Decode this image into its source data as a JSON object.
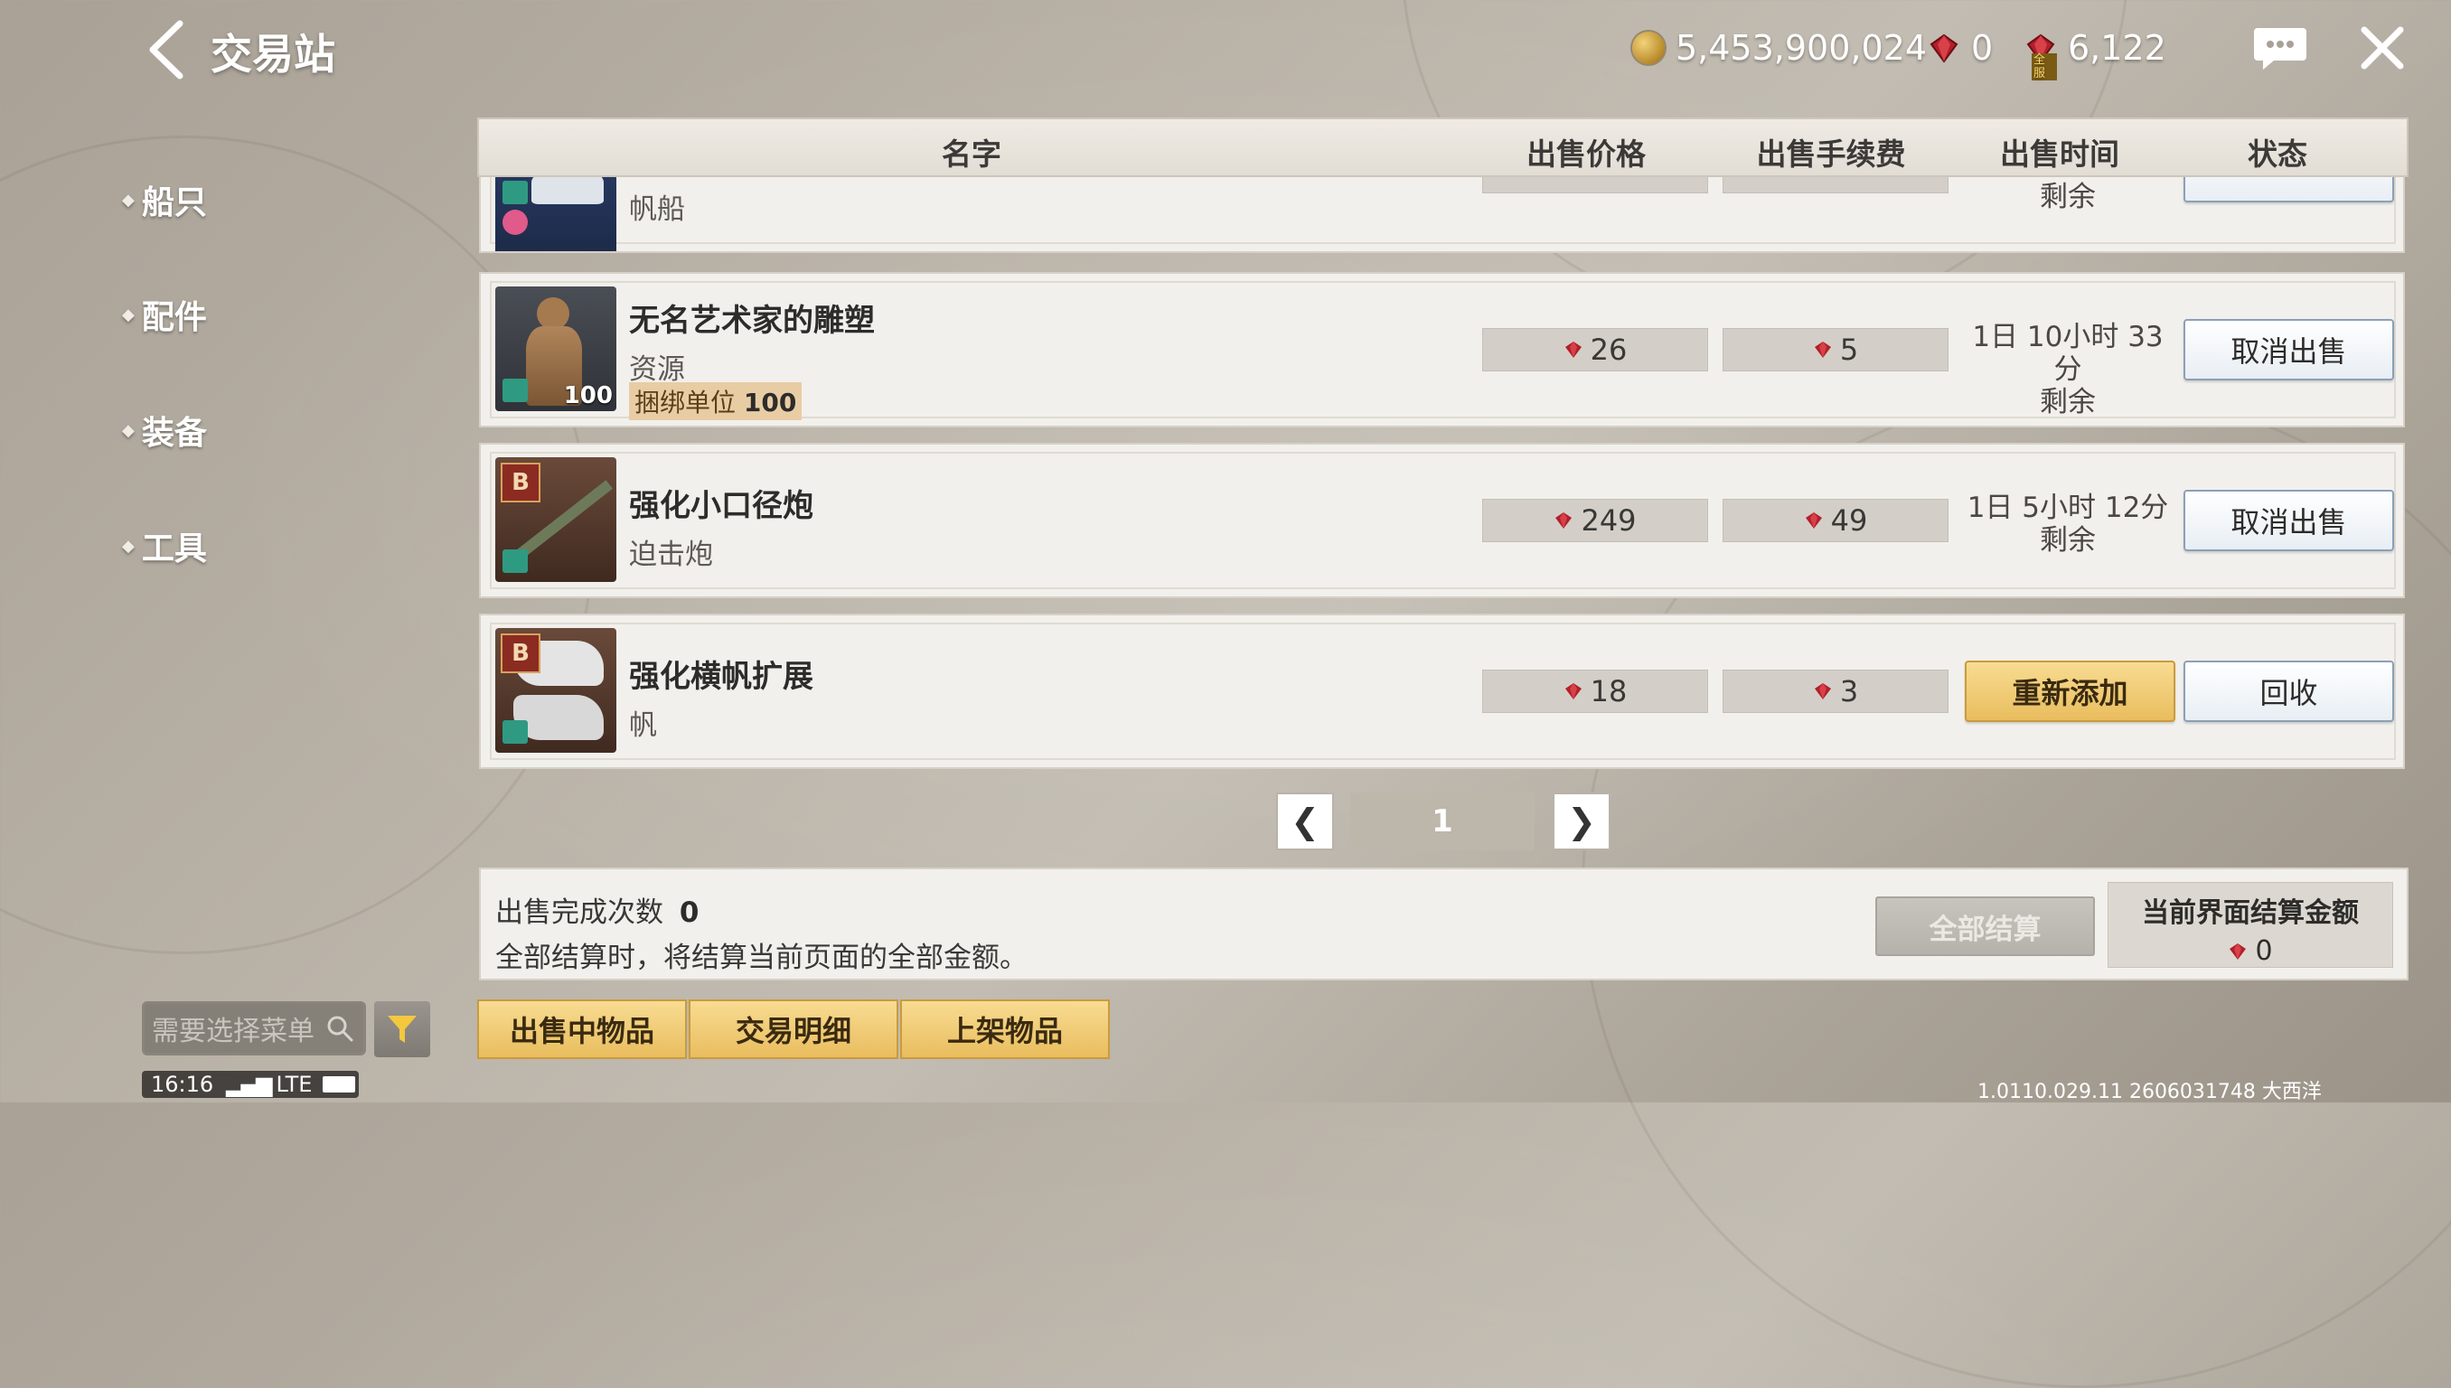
{
  "header": {
    "title": "交易站",
    "gold": "5,453,900,024",
    "gems": "0",
    "paid_gems": "6,122",
    "paid_gem_tag": "全服"
  },
  "sidebar": {
    "items": [
      {
        "label": "船只"
      },
      {
        "label": "配件"
      },
      {
        "label": "装备"
      },
      {
        "label": "工具"
      }
    ]
  },
  "table": {
    "columns": [
      "名字",
      "出售价格",
      "出售手续费",
      "出售时间",
      "状态"
    ],
    "rows": [
      {
        "name": "",
        "type": "帆船",
        "time_line2": "剩余"
      },
      {
        "name": "无名艺术家的雕塑",
        "type": "资源",
        "qty": "100",
        "bundle_label": "捆绑单位",
        "bundle_value": "100",
        "price": "26",
        "fee": "5",
        "time": "1日 10小时 33分",
        "time_line2": "剩余",
        "action": "取消出售"
      },
      {
        "name": "强化小口径炮",
        "type": "迫击炮",
        "grade": "B",
        "price": "249",
        "fee": "49",
        "time": "1日 5小时 12分",
        "time_line2": "剩余",
        "action": "取消出售"
      },
      {
        "name": "强化横帆扩展",
        "type": "帆",
        "grade": "B",
        "price": "18",
        "fee": "3",
        "action_primary": "重新添加",
        "action": "回收"
      }
    ]
  },
  "pager": {
    "page": "1",
    "prev": "❮",
    "next": "❯"
  },
  "summary": {
    "completed_label": "出售完成次数",
    "completed_value": "0",
    "note": "全部结算时，将结算当前页面的全部金额。",
    "settle_all": "全部结算",
    "current_amount_label": "当前界面结算金额",
    "current_amount_value": "0"
  },
  "bottom": {
    "search_placeholder": "需要选择菜单",
    "tabs": [
      "出售中物品",
      "交易明细",
      "上架物品"
    ],
    "status_time": "16:16",
    "status_net": "LTE",
    "version": "1.0110.029.11 2606031748 大西洋"
  },
  "colors": {
    "gold_button": "#e9bd5e",
    "ruby": "#b1202a",
    "teal_lock": "#2f9a82"
  }
}
